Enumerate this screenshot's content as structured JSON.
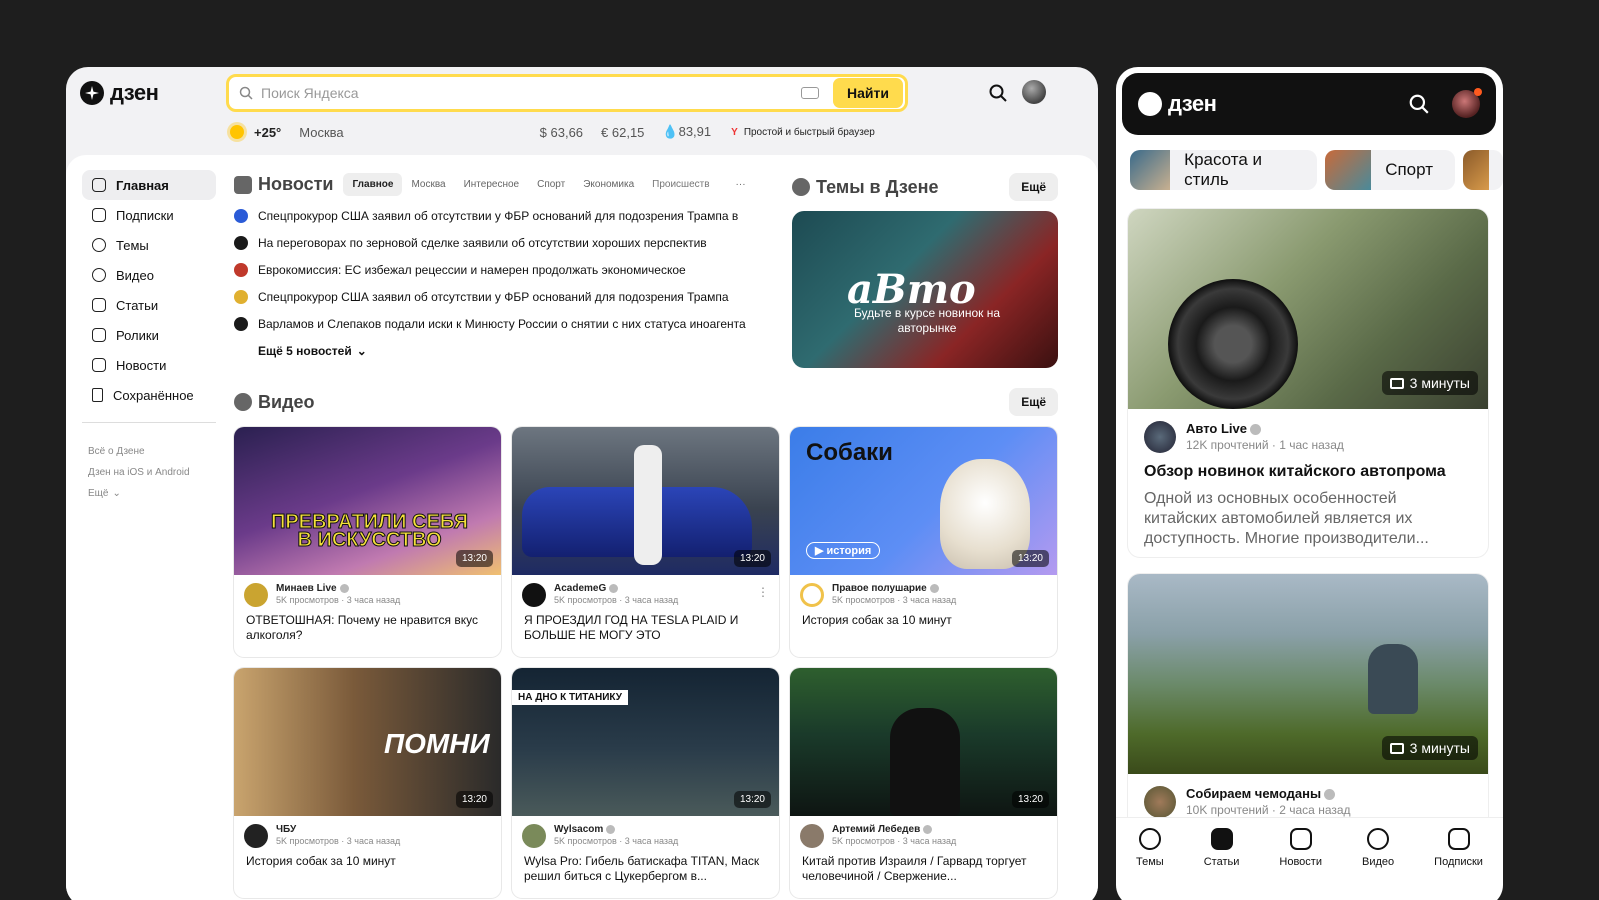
{
  "desktop": {
    "logo": "дзен",
    "search": {
      "placeholder": "Поиск Яндекса",
      "button": "Найти"
    },
    "info": {
      "temp": "+25°",
      "city": "Москва",
      "usd": "$ 63,66",
      "eur": "€ 62,15",
      "oil": "83,91",
      "browser": "Простой и быстрый браузер"
    },
    "nav": {
      "items": [
        "Главная",
        "Подписки",
        "Темы",
        "Видео",
        "Статьи",
        "Ролики",
        "Новости",
        "Сохранённое"
      ],
      "links": [
        "Всё о Дзене",
        "Дзен на iOS и Android",
        "Ещё"
      ]
    },
    "news": {
      "title": "Новости",
      "tabs": [
        "Главное",
        "Москва",
        "Интересное",
        "Спорт",
        "Экономика",
        "Происшеств"
      ],
      "more_dots": "···",
      "items": [
        {
          "text": "Спецпрокурор США заявил об отсутствии у ФБР оснований для подозрения Трампа в",
          "color": "#2b5bd7"
        },
        {
          "text": "На переговорах по зерновой сделке заявили об отсутствии хороших перспектив",
          "color": "#1a1a1a"
        },
        {
          "text": "Еврокомиссия: ЕС избежал рецессии и намерен продолжать экономическое",
          "color": "#c0392b"
        },
        {
          "text": "Спецпрокурор США заявил об отсутствии у ФБР оснований для подозрения Трампа",
          "color": "#e0b030"
        },
        {
          "text": "Варламов и Слепаков подали иски к Минюсту России о снятии с них статуса иноагента",
          "color": "#1a1a1a"
        }
      ],
      "more": "Ещё 5 новостей"
    },
    "topics": {
      "title": "Темы в Дзене",
      "more": "Ещё",
      "banner_word": "аВто",
      "banner_text": "Будьте в курсе новинок на авторынке"
    },
    "video": {
      "title": "Видео",
      "more": "Ещё",
      "cards": [
        {
          "duration": "13:20",
          "overlay": "ПРЕВРАТИЛИ СЕБЯ В ИСКУССТВО",
          "channel": "Минаев Live",
          "stats": "5K просмотров · 3 часа назад",
          "title": "ОТВЕТОШНАЯ: Почему не нравится вкус алкоголя?"
        },
        {
          "duration": "13:20",
          "overlay": "",
          "channel": "AcademeG",
          "stats": "5K просмотров · 3 часа назад",
          "title": "Я ПРОЕЗДИЛ ГОД НА TESLA PLAID И БОЛЬШЕ НЕ МОГУ ЭТО"
        },
        {
          "duration": "13:20",
          "overlay": "Собаки",
          "badge": "история",
          "channel": "Правое полушарие",
          "stats": "5K просмотров · 3 часа назад",
          "title": "История собак за 10 минут"
        },
        {
          "duration": "13:20",
          "overlay": "ПОМНИ",
          "channel": "ЧБУ",
          "stats": "5K просмотров · 3 часа назад",
          "title": "История собак за 10 минут"
        },
        {
          "duration": "13:20",
          "overlay": "НА ДНО К ТИТАНИКУ",
          "channel": "Wylsacom",
          "stats": "5K просмотров · 3 часа назад",
          "title": "Wylsa Pro: Гибель батискафа TITAN, Маск решил биться с Цукербергом в..."
        },
        {
          "duration": "13:20",
          "overlay": "",
          "channel": "Артемий Лебедев",
          "stats": "5K просмотров · 3 часа назад",
          "title": "Китай против Израиля / Гарвард торгует человечиной / Свержение..."
        }
      ]
    }
  },
  "mobile": {
    "logo": "дзен",
    "chips": [
      "Красота и стиль",
      "Спорт"
    ],
    "cards": [
      {
        "read": "3 минуты",
        "channel": "Авто Live",
        "stats": "12K прочтений · 1 час назад",
        "title": "Обзор новинок китайского автопрома",
        "text": "Одной из основных особенностей китайских автомобилей является их доступность. Многие производители..."
      },
      {
        "read": "3 минуты",
        "channel": "Собираем чемоданы",
        "stats": "10K прочтений · 2 часа назад"
      }
    ],
    "nav": [
      "Темы",
      "Статьи",
      "Новости",
      "Видео",
      "Подписки"
    ]
  }
}
